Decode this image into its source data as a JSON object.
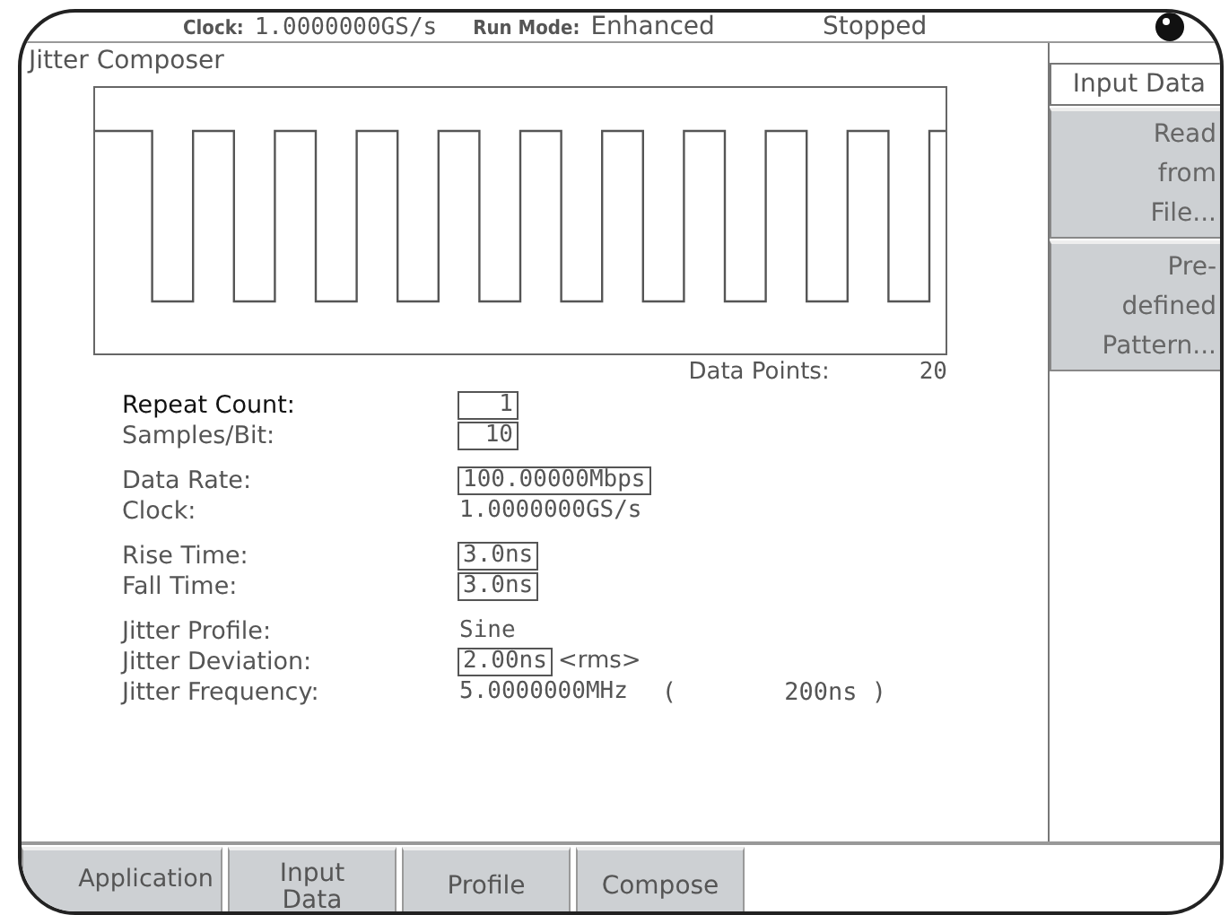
{
  "status_bar": {
    "clock_label": "Clock:",
    "clock_value": "1.0000000GS/s",
    "run_mode_label": "Run Mode:",
    "run_mode_value": "Enhanced",
    "state": "Stopped"
  },
  "panel": {
    "title": "Jitter Composer",
    "data_points_label": "Data Points:",
    "data_points_value": "20"
  },
  "groups": [
    [
      {
        "label": "Repeat Count:",
        "value": "1",
        "kind": "field",
        "selected": true
      },
      {
        "label": "Samples/Bit:",
        "value": "10",
        "kind": "field",
        "selected": false
      }
    ],
    [
      {
        "label": "Data Rate:",
        "value": "100.00000Mbps",
        "kind": "field",
        "selected": false
      },
      {
        "label": "Clock:",
        "value": "1.0000000GS/s",
        "kind": "text",
        "selected": false
      }
    ],
    [
      {
        "label": "Rise Time:",
        "value": "3.0ns",
        "kind": "field",
        "selected": false
      },
      {
        "label": "Fall Time:",
        "value": "3.0ns",
        "kind": "field",
        "selected": false
      }
    ],
    [
      {
        "label": "Jitter Profile:",
        "value": "Sine",
        "kind": "text",
        "selected": false
      },
      {
        "label": "Jitter Deviation:",
        "value": "2.00ns",
        "kind": "field",
        "selected": false,
        "suffix": "<rms>"
      },
      {
        "label": "Jitter Frequency:",
        "value": "5.0000000MHz",
        "kind": "text",
        "selected": false,
        "open": "(",
        "period": "200ns )"
      }
    ]
  ],
  "side_menu": {
    "title": "Input Data",
    "items": [
      "Read from File...",
      "Pre- defined Pattern..."
    ]
  },
  "tabs": [
    {
      "label": "Application"
    },
    {
      "label": "Input Data"
    },
    {
      "label": "Profile"
    },
    {
      "label": "Compose"
    }
  ]
}
